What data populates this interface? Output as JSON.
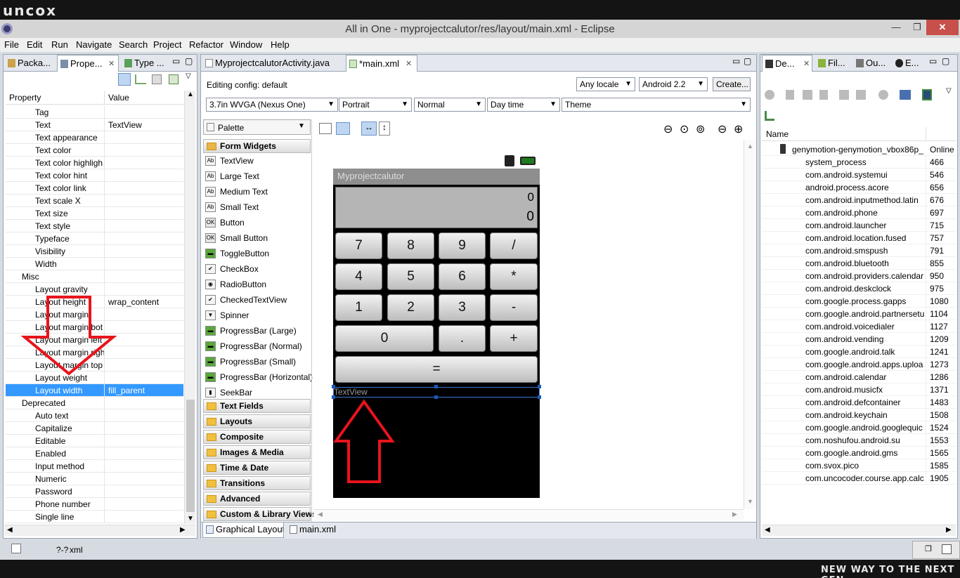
{
  "watermark": {
    "logo": "uncox",
    "slogan": "NEW WAY TO THE NEXT GEN ›"
  },
  "window": {
    "title": "All in One - myprojectcalutor/res/layout/main.xml - Eclipse",
    "min": "—",
    "max": "❐",
    "close": "✕"
  },
  "menu": [
    "File",
    "Edit",
    "Run",
    "Navigate",
    "Search",
    "Project",
    "Refactor",
    "Window",
    "Help"
  ],
  "left_tabs": [
    "Packa...",
    "Prope...",
    "Type ..."
  ],
  "properties": {
    "col_property": "Property",
    "col_value": "Value",
    "rows": [
      {
        "name": "Tag",
        "value": "",
        "indent": 2
      },
      {
        "name": "Text",
        "value": "TextView",
        "indent": 2
      },
      {
        "name": "Text appearance",
        "value": "",
        "indent": 2
      },
      {
        "name": "Text color",
        "value": "",
        "indent": 2
      },
      {
        "name": "Text color highligh",
        "value": "",
        "indent": 2
      },
      {
        "name": "Text color hint",
        "value": "",
        "indent": 2
      },
      {
        "name": "Text color link",
        "value": "",
        "indent": 2
      },
      {
        "name": "Text scale X",
        "value": "",
        "indent": 2
      },
      {
        "name": "Text size",
        "value": "",
        "indent": 2
      },
      {
        "name": "Text style",
        "value": "",
        "indent": 2
      },
      {
        "name": "Typeface",
        "value": "",
        "indent": 2
      },
      {
        "name": "Visibility",
        "value": "",
        "indent": 2
      },
      {
        "name": "Width",
        "value": "",
        "indent": 2
      },
      {
        "name": "Misc",
        "value": "",
        "indent": 1
      },
      {
        "name": "Layout gravity",
        "value": "",
        "indent": 2
      },
      {
        "name": "Layout height",
        "value": "wrap_content",
        "indent": 2
      },
      {
        "name": "Layout margin",
        "value": "",
        "indent": 2
      },
      {
        "name": "Layout margin bot",
        "value": "",
        "indent": 2
      },
      {
        "name": "Layout margin left",
        "value": "",
        "indent": 2
      },
      {
        "name": "Layout margin righ",
        "value": "",
        "indent": 2
      },
      {
        "name": "Layout margin top",
        "value": "",
        "indent": 2
      },
      {
        "name": "Layout weight",
        "value": "",
        "indent": 2
      },
      {
        "name": "Layout width",
        "value": "fill_parent",
        "indent": 2,
        "selected": true
      },
      {
        "name": "Deprecated",
        "value": "",
        "indent": 1
      },
      {
        "name": "Auto text",
        "value": "",
        "indent": 2
      },
      {
        "name": "Capitalize",
        "value": "",
        "indent": 2
      },
      {
        "name": "Editable",
        "value": "",
        "indent": 2
      },
      {
        "name": "Enabled",
        "value": "",
        "indent": 2
      },
      {
        "name": "Input method",
        "value": "",
        "indent": 2
      },
      {
        "name": "Numeric",
        "value": "",
        "indent": 2
      },
      {
        "name": "Password",
        "value": "",
        "indent": 2
      },
      {
        "name": "Phone number",
        "value": "",
        "indent": 2
      },
      {
        "name": "Single line",
        "value": "",
        "indent": 2
      }
    ]
  },
  "editor_tabs": [
    "MyprojectcalutorActivity.java",
    "*main.xml"
  ],
  "config": {
    "editing_label": "Editing config:  default",
    "locale": "Any locale",
    "api": "Android 2.2",
    "create": "Create...",
    "device": "3.7in WVGA (Nexus One)",
    "orientation": "Portrait",
    "mode": "Normal",
    "time": "Day time",
    "theme": "Theme"
  },
  "palette": {
    "title": "Palette",
    "form_widgets": "Form Widgets",
    "widgets": [
      {
        "icon": "Ab",
        "label": "TextView"
      },
      {
        "icon": "Ab",
        "label": "Large Text"
      },
      {
        "icon": "Ab",
        "label": "Medium Text"
      },
      {
        "icon": "Ab",
        "label": "Small Text"
      },
      {
        "icon": "OK",
        "label": "Button"
      },
      {
        "icon": "OK",
        "label": "Small Button"
      },
      {
        "icon": "▬",
        "label": "ToggleButton"
      },
      {
        "icon": "✔",
        "label": "CheckBox"
      },
      {
        "icon": "◉",
        "label": "RadioButton"
      },
      {
        "icon": "✔",
        "label": "CheckedTextView"
      },
      {
        "icon": "▼",
        "label": "Spinner"
      },
      {
        "icon": "▬",
        "label": "ProgressBar (Large)"
      },
      {
        "icon": "▬",
        "label": "ProgressBar (Normal)"
      },
      {
        "icon": "▬",
        "label": "ProgressBar (Small)"
      },
      {
        "icon": "▬",
        "label": "ProgressBar (Horizontal)"
      },
      {
        "icon": "▮",
        "label": "SeekBar"
      }
    ],
    "categories": [
      "Text Fields",
      "Layouts",
      "Composite",
      "Images & Media",
      "Time & Date",
      "Transitions",
      "Advanced",
      "Custom & Library Views"
    ]
  },
  "phone": {
    "app_title": "Myprojectcalutor",
    "display_top": "0",
    "display_bottom": "0",
    "buttons": [
      [
        "7",
        "8",
        "9",
        "/"
      ],
      [
        "4",
        "5",
        "6",
        "*"
      ],
      [
        "1",
        "2",
        "3",
        "-"
      ]
    ],
    "row4": [
      "0",
      ".",
      "+"
    ],
    "equals": "=",
    "textview": "TextView"
  },
  "editor_bottom_tabs": [
    "Graphical Layout",
    "main.xml"
  ],
  "right_tabs": [
    "De...",
    "Fil...",
    "Ou...",
    "E..."
  ],
  "devices": {
    "col_name": "Name",
    "device": "genymotion-genymotion_vbox86p_",
    "device_status": "Online",
    "processes": [
      {
        "name": "system_process",
        "pid": "466"
      },
      {
        "name": "com.android.systemui",
        "pid": "546"
      },
      {
        "name": "android.process.acore",
        "pid": "656"
      },
      {
        "name": "com.android.inputmethod.latin",
        "pid": "676"
      },
      {
        "name": "com.android.phone",
        "pid": "697"
      },
      {
        "name": "com.android.launcher",
        "pid": "715"
      },
      {
        "name": "com.android.location.fused",
        "pid": "757"
      },
      {
        "name": "com.android.smspush",
        "pid": "791"
      },
      {
        "name": "com.android.bluetooth",
        "pid": "855"
      },
      {
        "name": "com.android.providers.calendar",
        "pid": "950"
      },
      {
        "name": "com.android.deskclock",
        "pid": "975"
      },
      {
        "name": "com.google.process.gapps",
        "pid": "1080"
      },
      {
        "name": "com.google.android.partnersetu",
        "pid": "1104"
      },
      {
        "name": "com.android.voicedialer",
        "pid": "1127"
      },
      {
        "name": "com.android.vending",
        "pid": "1209"
      },
      {
        "name": "com.google.android.talk",
        "pid": "1241"
      },
      {
        "name": "com.google.android.apps.uploa",
        "pid": "1273"
      },
      {
        "name": "com.android.calendar",
        "pid": "1286"
      },
      {
        "name": "com.android.musicfx",
        "pid": "1371"
      },
      {
        "name": "com.android.defcontainer",
        "pid": "1483"
      },
      {
        "name": "com.android.keychain",
        "pid": "1508"
      },
      {
        "name": "com.google.android.googlequic",
        "pid": "1524"
      },
      {
        "name": "com.noshufou.android.su",
        "pid": "1553"
      },
      {
        "name": "com.google.android.gms",
        "pid": "1565"
      },
      {
        "name": "com.svox.pico",
        "pid": "1585"
      },
      {
        "name": "com.uncocoder.course.app.calc",
        "pid": "1905"
      }
    ]
  },
  "status": {
    "xml_label": "xml",
    "xml_icon_text": "?-?"
  },
  "colors": {
    "selection": "#3399ff",
    "annotation": "#e8141c",
    "close_button": "#c7504b"
  }
}
